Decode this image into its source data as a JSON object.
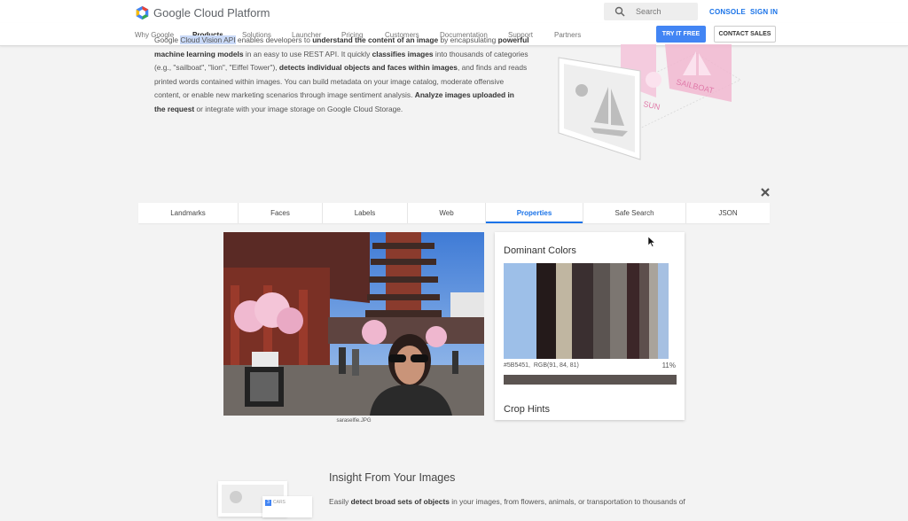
{
  "header": {
    "brand": "Google Cloud Platform",
    "search_label": "Search",
    "console_link": "CONSOLE",
    "signin_link": "SIGN IN"
  },
  "nav": {
    "items": [
      "Why Google",
      "Products",
      "Solutions",
      "Launcher",
      "Pricing",
      "Customers",
      "Documentation",
      "Support",
      "Partners"
    ],
    "active": "Products",
    "try_free": "TRY IT FREE",
    "contact_sales": "CONTACT SALES"
  },
  "intro": {
    "line1_a": "Google",
    "line1_b": "Cloud Vision API",
    "line1_c": "enables developers to",
    "line1_d": "understand the content of an image",
    "line1_e": "by encapsulating",
    "line1_f": "powerful",
    "line2_a": "machine learning models",
    "line2_b": "in an easy to use REST API. It quickly",
    "line2_c": "classifies images",
    "line2_d": "into thousands of categories",
    "line3_a": "(e.g., \"sailboat\", \"lion\", \"Eiffel Tower\"),",
    "line3_b": "detects individual objects and faces within images",
    "line3_c": ", and finds and reads",
    "line4": "printed words contained within images. You can build metadata on your image catalog, moderate offensive",
    "line5_a": "content, or enable new marketing scenarios through image sentiment analysis.",
    "line5_b": "Analyze images uploaded in",
    "line6_a": "the request",
    "line6_b": "or integrate with your image storage on Google Cloud Storage."
  },
  "illustration": {
    "label_sun": "SUN",
    "label_sailboat": "SAILBOAT"
  },
  "tabs": {
    "items": [
      "Landmarks",
      "Faces",
      "Labels",
      "Web",
      "Properties",
      "Safe Search",
      "JSON"
    ],
    "active": "Properties"
  },
  "photo": {
    "caption": "saraselfie.JPG"
  },
  "properties": {
    "title": "Dominant Colors",
    "swatches": [
      "#9dbfe8",
      "#241a1a",
      "#c0b6a1",
      "#3a2f30",
      "#5b5451",
      "#7c7671",
      "#3c2628",
      "#5d4f4d",
      "#a9a39b",
      "#a6c0e2"
    ],
    "selected_hex": "#5B5451",
    "selected_rgb": "RGB(91, 84, 81)",
    "selected_color": "#5b5451",
    "selected_pct": "11%",
    "crop_title": "Crop Hints"
  },
  "insight": {
    "title": "Insight From Your Images",
    "text_a": "Easily",
    "text_b": "detect broad sets of objects",
    "text_c": "in your images, from flowers, animals, or transportation to thousands of",
    "badge": "3",
    "thumb_label": "CARS"
  }
}
